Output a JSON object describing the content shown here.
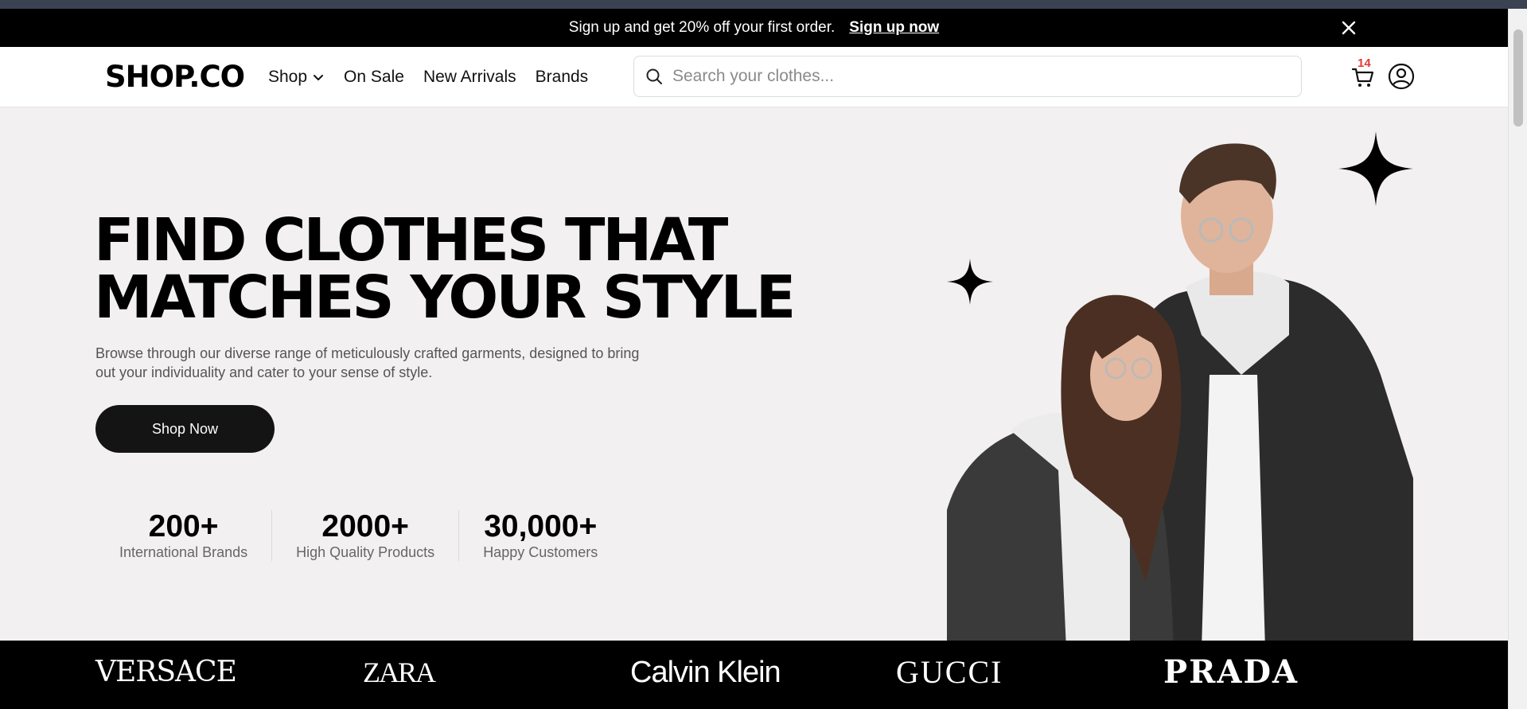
{
  "promo": {
    "text": "Sign up and get 20% off your first order.",
    "cta": "Sign up now",
    "close_icon": "close-icon"
  },
  "header": {
    "logo": "SHOP.CO",
    "nav": [
      {
        "label": "Shop",
        "has_dropdown": true
      },
      {
        "label": "On Sale"
      },
      {
        "label": "New Arrivals"
      },
      {
        "label": "Brands"
      }
    ],
    "search": {
      "placeholder": "Search your clothes...",
      "value": "",
      "icon": "search-icon"
    },
    "cart": {
      "icon": "cart-icon",
      "count": "14"
    },
    "account_icon": "user-circle-icon"
  },
  "hero": {
    "title_line1": "FIND CLOTHES THAT",
    "title_line2": "MATCHES YOUR STYLE",
    "description_line1": "Browse through our diverse range of meticulously crafted garments, designed to bring",
    "description_line2": "out your individuality and cater to your sense of style.",
    "button": "Shop Now",
    "stats": [
      {
        "value": "200+",
        "label": "International Brands"
      },
      {
        "value": "2000+",
        "label": "High Quality Products"
      },
      {
        "value": "30,000+",
        "label": "Happy Customers"
      }
    ]
  },
  "brands": [
    "VERSACE",
    "ZARA",
    "Calvin Klein",
    "GUCCI",
    "PRADA"
  ],
  "colors": {
    "accent": "#000000",
    "badge": "#e53935",
    "hero_bg": "#f2f0f1",
    "button": "#141414"
  }
}
